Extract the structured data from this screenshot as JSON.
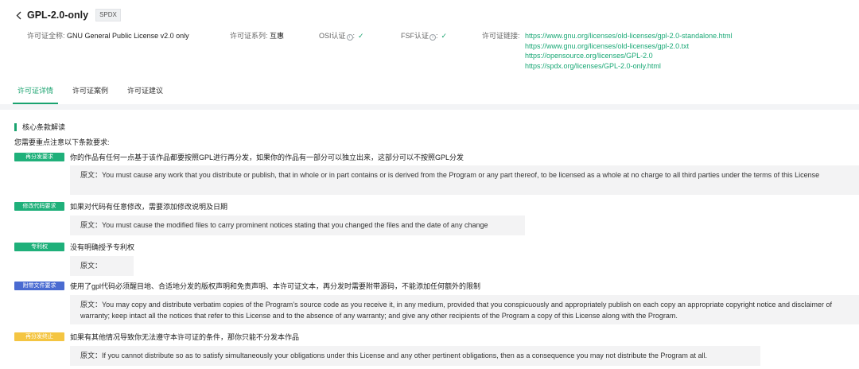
{
  "header": {
    "title": "GPL-2.0-only",
    "badge": "SPDX",
    "full_name_label": "许可证全称:",
    "full_name": "GNU General Public License v2.0 only",
    "series_label": "许可证系列:",
    "series": "互惠",
    "osi_label": "OSI认证",
    "fsf_label": "FSF认证",
    "check": "✓",
    "info": "i",
    "links_label": "许可证链接:",
    "links": [
      "https://www.gnu.org/licenses/old-licenses/gpl-2.0-standalone.html",
      "https://www.gnu.org/licenses/old-licenses/gpl-2.0.txt",
      "https://opensource.org/licenses/GPL-2.0",
      "https://spdx.org/licenses/GPL-2.0-only.html"
    ]
  },
  "tabs": [
    "许可证详情",
    "许可证案例",
    "许可证建议"
  ],
  "section": {
    "title": "核心条款解读",
    "intro": "您需要重点注意以下条款要求:"
  },
  "items": [
    {
      "tag": "再分发要求",
      "text": "你的作品有任何一点基于该作品都要按照GPL进行再分发，如果你的作品有一部分可以独立出来，这部分可以不按照GPL分发",
      "quote": "原文：You must cause any work that you distribute or publish, that in whole or in part contains or is derived from the Program or any part thereof, to be licensed as a whole at no charge to all third parties under the terms of this License"
    },
    {
      "tag": "修改代码要求",
      "text": "如果对代码有任意修改，需要添加修改说明及日期",
      "quote": "原文：You must cause the modified files to carry prominent notices stating that you changed the files and the date of any change"
    },
    {
      "tag": "专利权",
      "text": "没有明确授予专利权",
      "quote": "原文："
    },
    {
      "tag": "附带文件要求",
      "text": "使用了gpl代码必须醒目地、合适地分发的版权声明和免责声明、本许可证文本，再分发时需要附带源码，不能添加任何额外的限制",
      "quote": "原文：You may copy and distribute verbatim copies of the Program’s source code as you receive it, in any medium, provided that you conspicuously and appropriately publish on each copy an appropriate copyright notice and disclaimer of warranty; keep intact all the notices that refer to this License and to the absence of any warranty; and give any other recipients of the Program a copy of this License along with the Program."
    },
    {
      "tag": "再分发终止",
      "text": "如果有其他情况导致你无法遵守本许可证的条件，那你只能不分发本作品",
      "quote": "原文：If you cannot distribute so as to satisfy simultaneously your obligations under this License and any other pertinent obligations, then as a consequence you may not distribute the Program at all."
    }
  ]
}
